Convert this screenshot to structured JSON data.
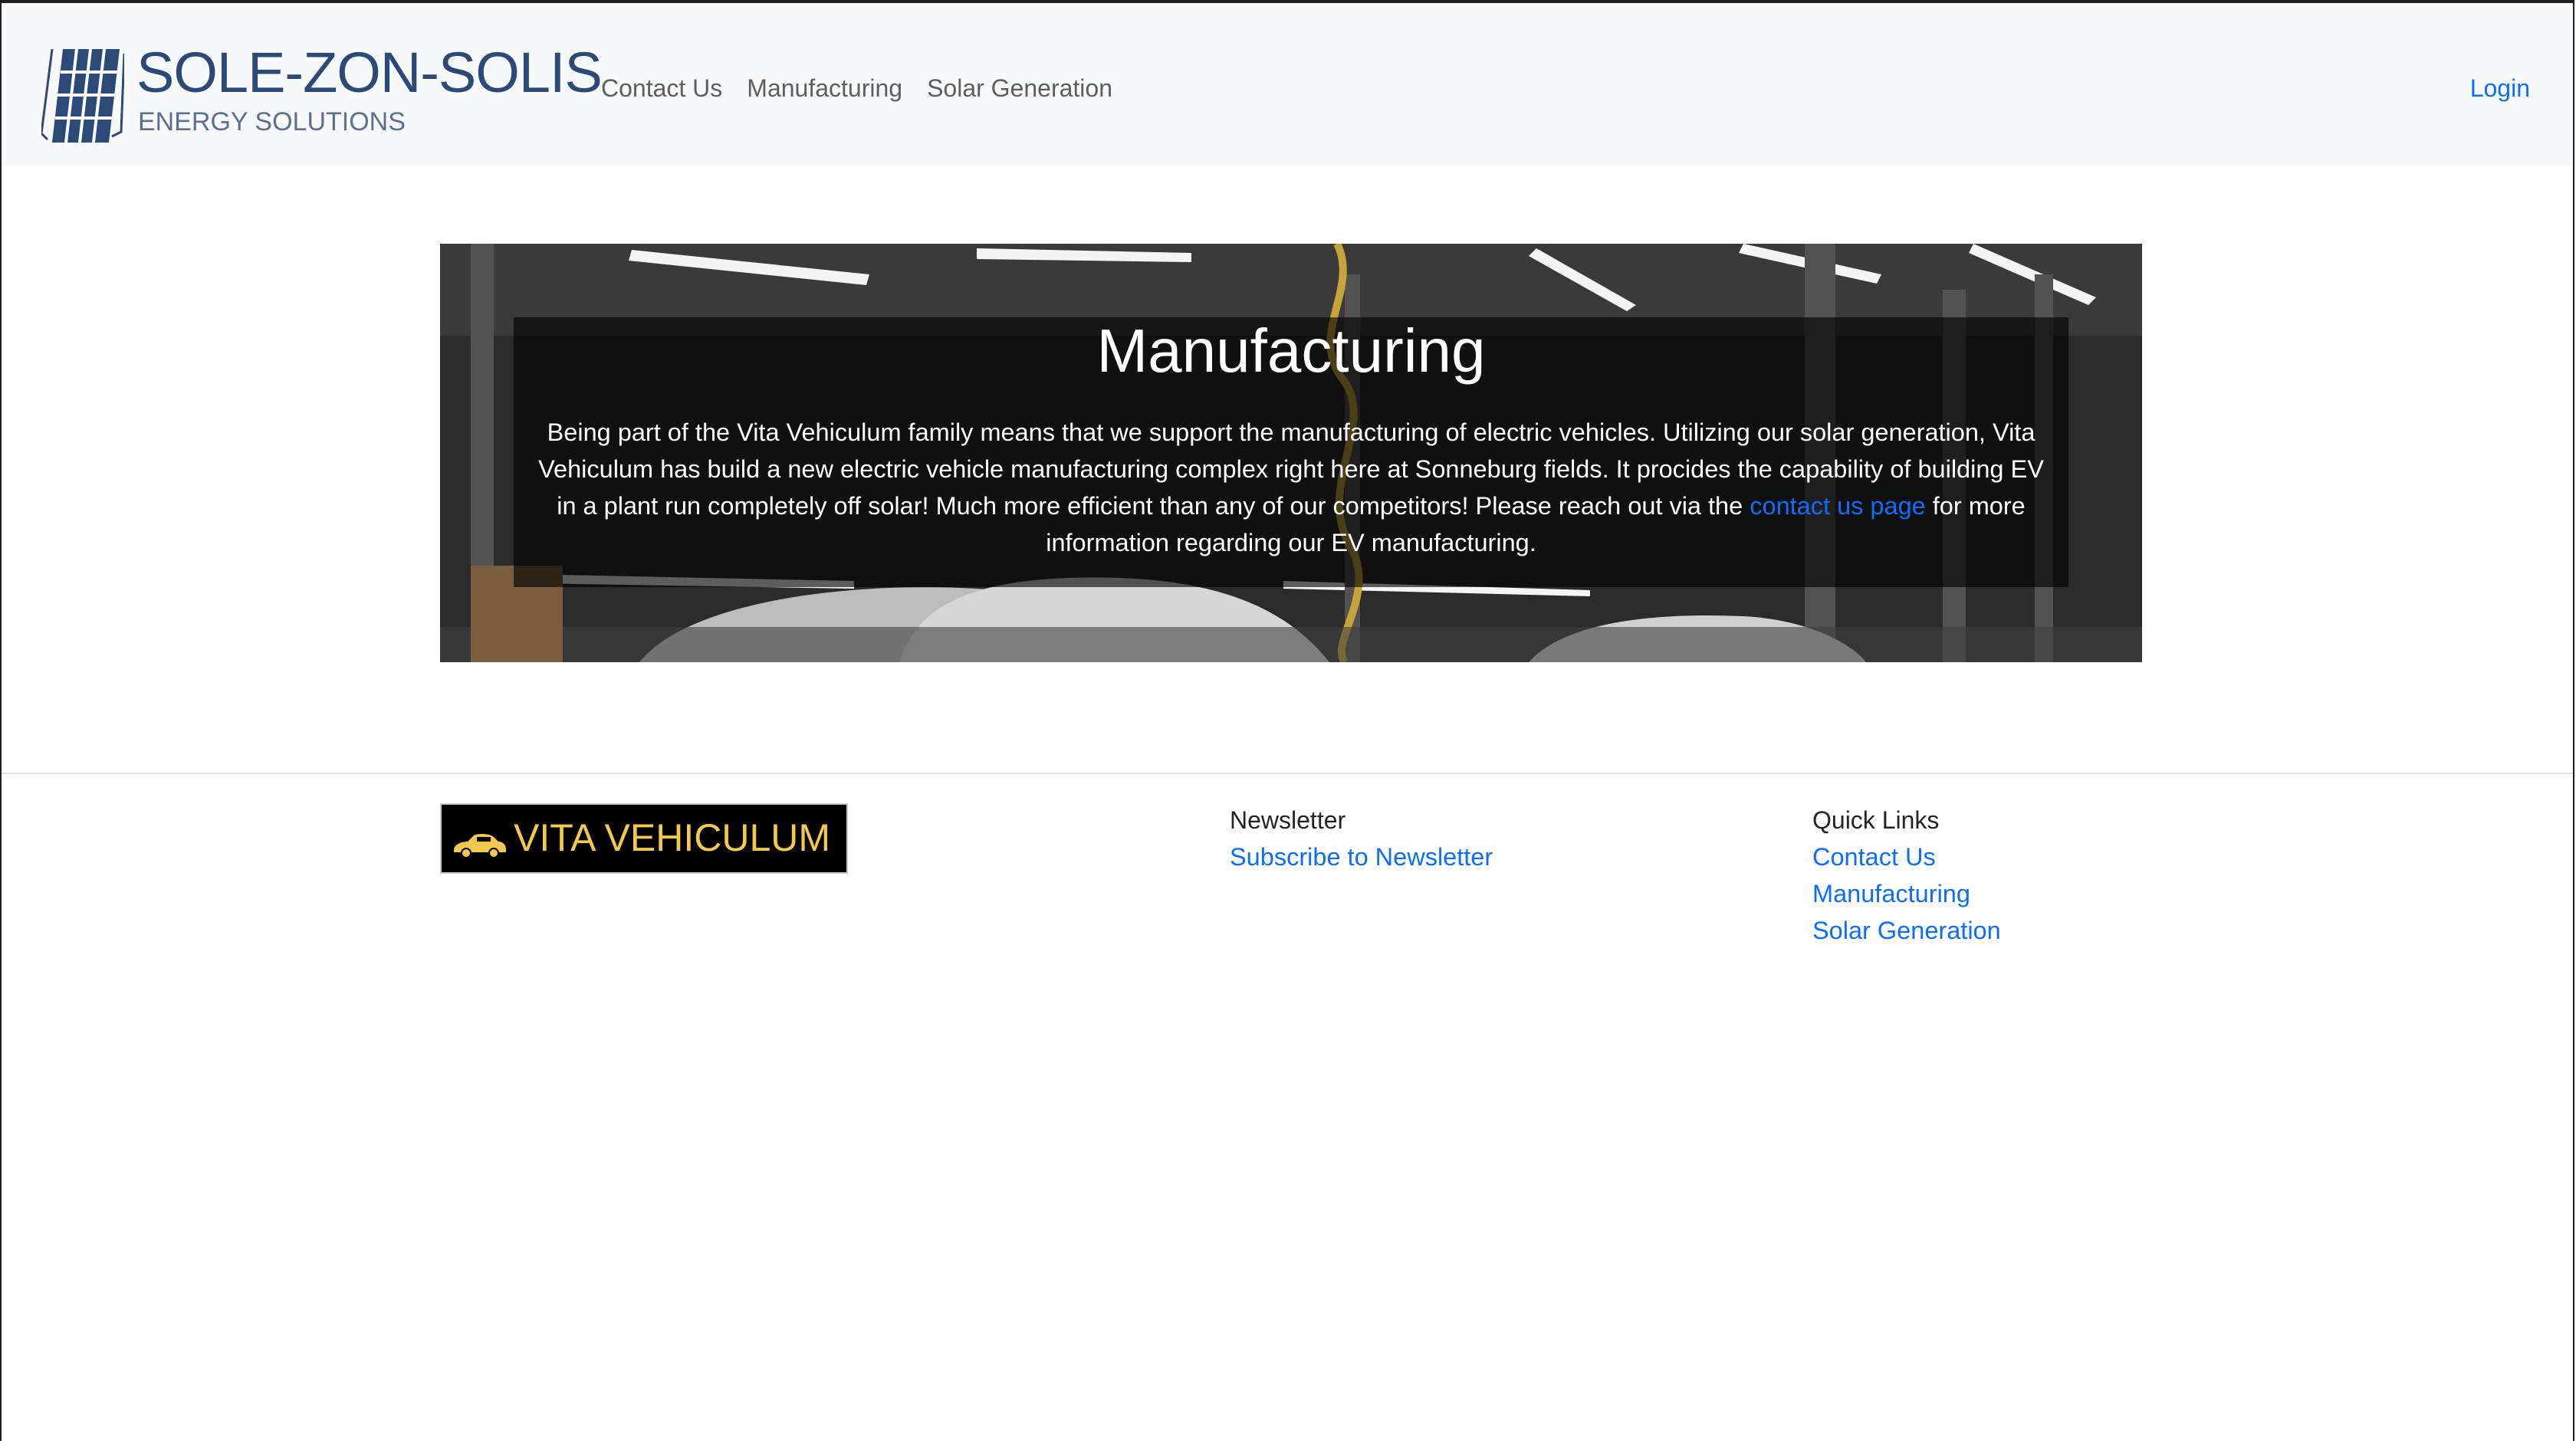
{
  "brand": {
    "name": "SOLE-ZON-SOLIS",
    "subtitle": "ENERGY SOLUTIONS",
    "icon": "solar-panel-icon"
  },
  "nav": {
    "links": [
      {
        "label": "Contact Us"
      },
      {
        "label": "Manufacturing"
      },
      {
        "label": "Solar Generation"
      }
    ],
    "login_label": "Login"
  },
  "hero": {
    "title": "Manufacturing",
    "text_before_link": "Being part of the Vita Vehiculum family means that we support the manufacturing of electric vehicles. Utilizing our solar generation, Vita Vehiculum has build a new electric vehicle manufacturing complex right here at Sonneburg fields. It procides the capability of building EV in a plant run completely off solar! Much more efficient than any of our competitors! Please reach out via the ",
    "link_label": "contact us page",
    "text_after_link": " for more information regarding our EV manufacturing."
  },
  "footer": {
    "partner_logo": {
      "text": "VITA VEHICULUM",
      "icon": "car-icon",
      "text_color": "#f2c94c"
    },
    "newsletter": {
      "heading": "Newsletter",
      "link_label": "Subscribe to Newsletter"
    },
    "quick_links": {
      "heading": "Quick Links",
      "links": [
        {
          "label": "Contact Us"
        },
        {
          "label": "Manufacturing"
        },
        {
          "label": "Solar Generation"
        }
      ]
    }
  },
  "colors": {
    "link": "#0d6efd",
    "navbar_bg": "#f8f9fa",
    "brand": "#2b4a78"
  }
}
